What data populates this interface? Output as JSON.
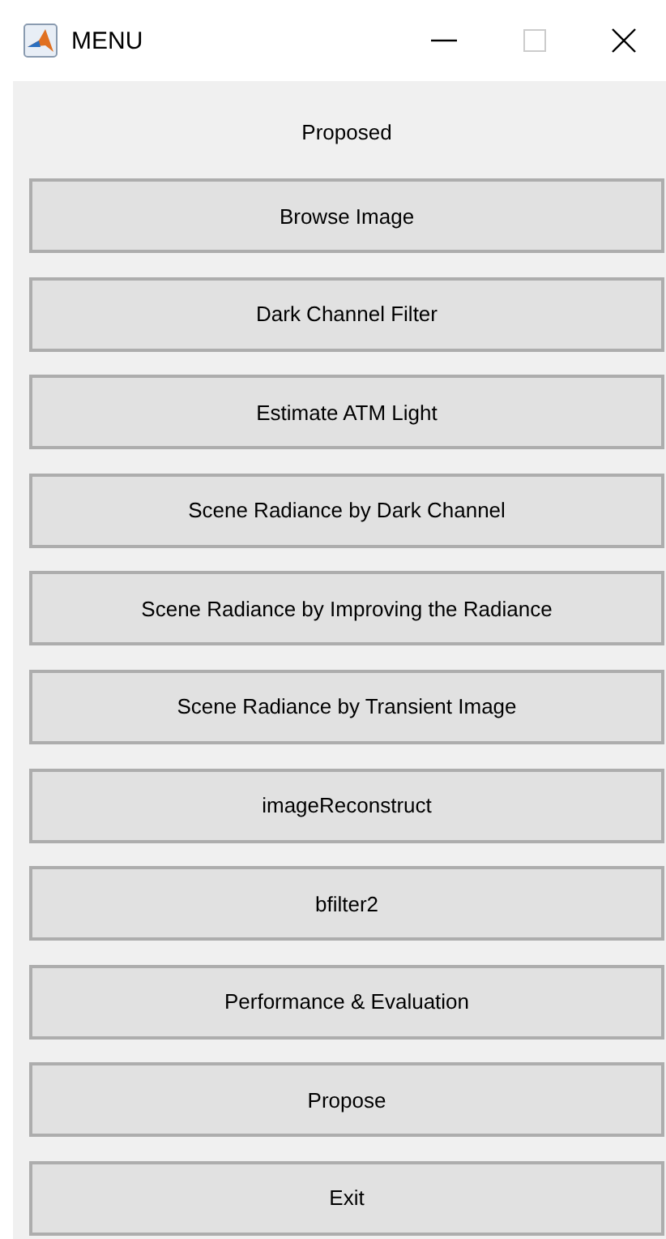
{
  "window": {
    "title": "MENU"
  },
  "panel": {
    "heading": "Proposed",
    "buttons": [
      {
        "label": "Browse Image"
      },
      {
        "label": "Dark Channel Filter"
      },
      {
        "label": "Estimate ATM Light"
      },
      {
        "label": "Scene Radiance by Dark Channel"
      },
      {
        "label": "Scene Radiance by Improving the Radiance"
      },
      {
        "label": "Scene Radiance by Transient Image"
      },
      {
        "label": "imageReconstruct"
      },
      {
        "label": "bfilter2"
      },
      {
        "label": "Performance & Evaluation"
      },
      {
        "label": "Propose"
      },
      {
        "label": "Exit"
      }
    ]
  }
}
